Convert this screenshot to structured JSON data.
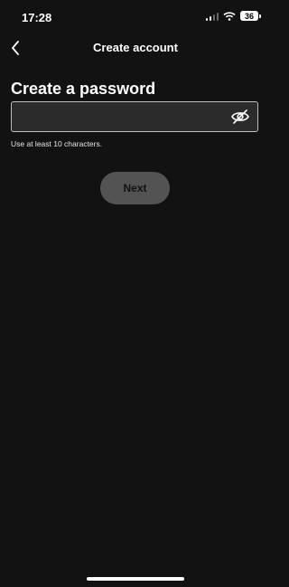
{
  "status_bar": {
    "time": "17:28",
    "battery": "36"
  },
  "nav": {
    "title": "Create account",
    "back_icon": "chevron-left-icon"
  },
  "form": {
    "heading": "Create a password",
    "password_value": "",
    "password_placeholder": "",
    "toggle_icon": "eye-slash-icon",
    "hint": "Use at least 10 characters."
  },
  "actions": {
    "next_label": "Next"
  },
  "colors": {
    "background": "#121212",
    "field_bg": "#2b2b2b",
    "button_bg": "#535353",
    "text": "#ffffff"
  }
}
